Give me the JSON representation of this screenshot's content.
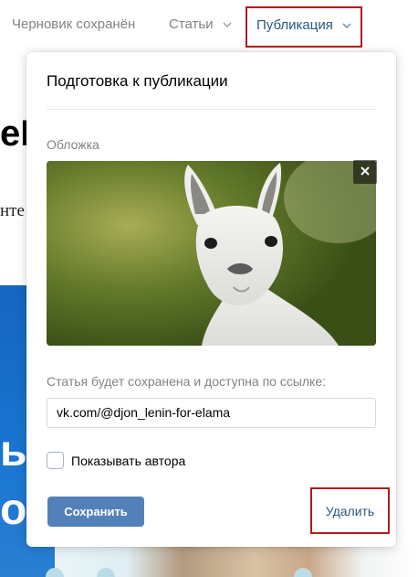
{
  "nav": {
    "draft_status": "Черновик сохранён",
    "articles": "Статьи",
    "publication": "Публикация"
  },
  "background": {
    "heading_fragment": "eL",
    "serif_fragment": "нте",
    "banner_fragment": "ь\nо"
  },
  "popup": {
    "title": "Подготовка к публикации",
    "cover_label": "Обложка",
    "link_label": "Статья будет сохранена и доступна по ссылке:",
    "link_value": "vk.com/@djon_lenin-for-elama",
    "show_author_label": "Показывать автора",
    "show_author_checked": false,
    "save_label": "Сохранить",
    "delete_label": "Удалить"
  },
  "colors": {
    "accent_link": "#2a5885",
    "button_blue": "#5181b8",
    "highlight_red": "#b01c1c",
    "muted_text": "#828282"
  }
}
